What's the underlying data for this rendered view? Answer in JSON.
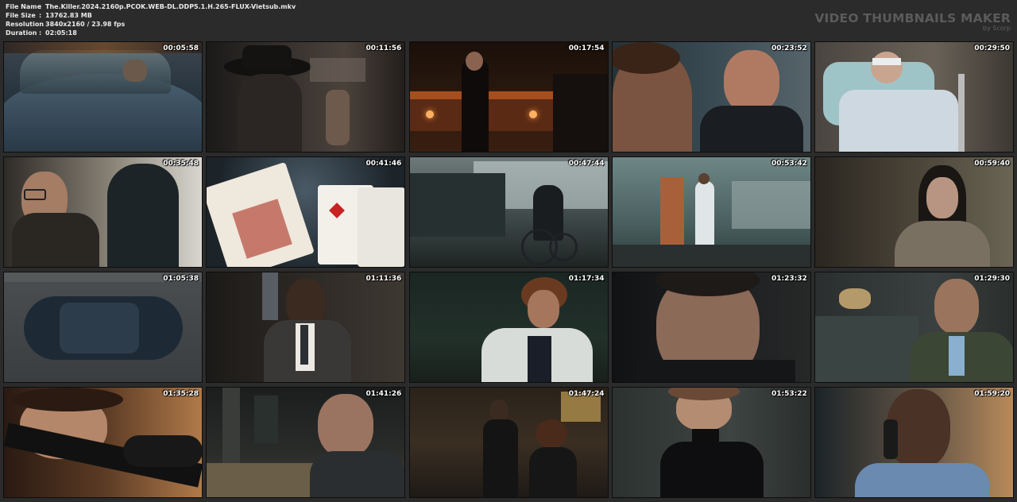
{
  "info": {
    "rows": [
      {
        "label": "File Name",
        "sep": ":",
        "value": "The.Killer.2024.2160p.PCOK.WEB-DL.DDP5.1.H.265-FLUX-Vietsub.mkv"
      },
      {
        "label": "File Size",
        "sep": ":",
        "value": "13762.83 MB"
      },
      {
        "label": "Resolution",
        "sep": ":",
        "value": "3840x2160 / 23.98 fps"
      },
      {
        "label": "Duration",
        "sep": ":",
        "value": "02:05:18"
      }
    ]
  },
  "brand": {
    "title": "VIDEO THUMBNAILS MAKER",
    "subtitle": "by Scorp"
  },
  "thumbnails": [
    {
      "time": "00:05:58",
      "scene": "car-windshield"
    },
    {
      "time": "00:11:56",
      "scene": "hat-figure-window"
    },
    {
      "time": "00:17:54",
      "scene": "woman-red-lounge"
    },
    {
      "time": "00:23:52",
      "scene": "two-faces-closeup"
    },
    {
      "time": "00:29:50",
      "scene": "hospital-bed"
    },
    {
      "time": "00:35:48",
      "scene": "old-man-glasses"
    },
    {
      "time": "00:41:46",
      "scene": "playing-cards"
    },
    {
      "time": "00:47:44",
      "scene": "wheelchair-room"
    },
    {
      "time": "00:53:42",
      "scene": "hospital-corridor"
    },
    {
      "time": "00:59:40",
      "scene": "woman-dark-hair"
    },
    {
      "time": "01:05:38",
      "scene": "car-top-view"
    },
    {
      "time": "01:11:36",
      "scene": "man-suit-dark"
    },
    {
      "time": "01:17:34",
      "scene": "woman-curly-hair"
    },
    {
      "time": "01:23:32",
      "scene": "man-closeup"
    },
    {
      "time": "01:29:30",
      "scene": "man-office"
    },
    {
      "time": "01:35:28",
      "scene": "woman-sniper"
    },
    {
      "time": "01:41:26",
      "scene": "church-interior"
    },
    {
      "time": "01:47:24",
      "scene": "couple-church"
    },
    {
      "time": "01:53:22",
      "scene": "woman-turtleneck"
    },
    {
      "time": "01:59:20",
      "scene": "man-phone"
    }
  ]
}
